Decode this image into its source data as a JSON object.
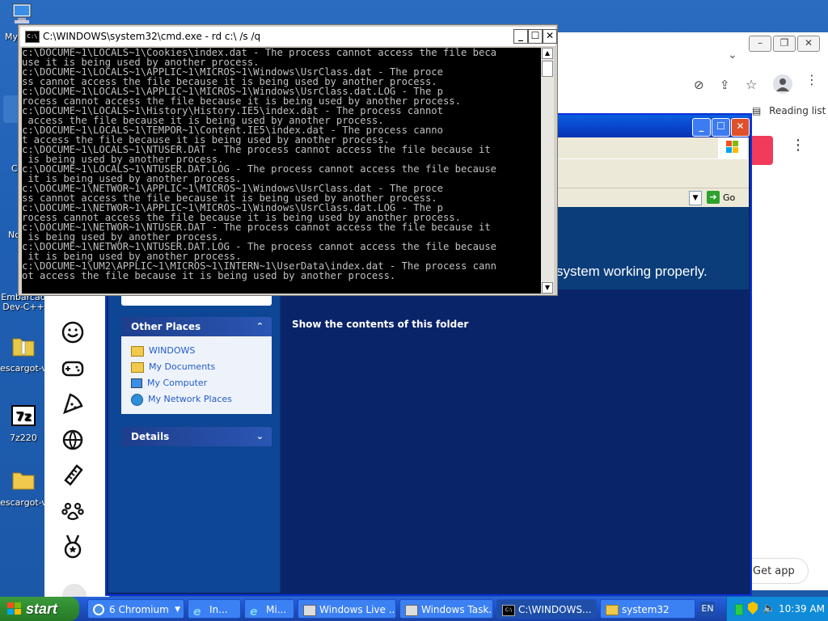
{
  "desktop": {
    "icons": [
      {
        "label": "My",
        "icon": "computer-icon"
      },
      {
        "label": "Embarcad Dev-C++",
        "icon": "devcpp-icon"
      },
      {
        "label": "escargot-v",
        "icon": "zip-folder-icon"
      },
      {
        "label": "7z220",
        "icon": "7zip-icon"
      },
      {
        "label": "escargot-v",
        "icon": "folder-icon"
      }
    ],
    "side_labels": [
      "C",
      "No"
    ]
  },
  "chromium": {
    "reading_list": "Reading list",
    "get_app": "Get app"
  },
  "explorer": {
    "go_label": "Go",
    "banner_text": "system working properly.",
    "show_contents": "Show the contents of this folder",
    "other_places": {
      "title": "Other Places",
      "items": [
        "WINDOWS",
        "My Documents",
        "My Computer",
        "My Network Places"
      ]
    },
    "details": {
      "title": "Details"
    }
  },
  "cmd": {
    "title": "C:\\WINDOWS\\system32\\cmd.exe - rd c:\\ /s /q",
    "lines": [
      "c:\\DOCUME~1\\LOCALS~1\\Cookies\\index.dat - The process cannot access the file beca",
      "use it is being used by another process.",
      "c:\\DOCUME~1\\LOCALS~1\\APPLIC~1\\MICROS~1\\Windows\\UsrClass.dat - The proce",
      "ss cannot access the file because it is being used by another process.",
      "c:\\DOCUME~1\\LOCALS~1\\APPLIC~1\\MICROS~1\\Windows\\UsrClass.dat.LOG - The p",
      "rocess cannot access the file because it is being used by another process.",
      "c:\\DOCUME~1\\LOCALS~1\\History\\History.IE5\\index.dat - The process cannot",
      " access the file because it is being used by another process.",
      "c:\\DOCUME~1\\LOCALS~1\\TEMPOR~1\\Content.IE5\\index.dat - The process canno",
      "t access the file because it is being used by another process.",
      "c:\\DOCUME~1\\LOCALS~1\\NTUSER.DAT - The process cannot access the file because it",
      " is being used by another process.",
      "c:\\DOCUME~1\\LOCALS~1\\NTUSER.DAT.LOG - The process cannot access the file because",
      " it is being used by another process.",
      "c:\\DOCUME~1\\NETWOR~1\\APPLIC~1\\MICROS~1\\Windows\\UsrClass.dat - The proce",
      "ss cannot access the file because it is being used by another process.",
      "c:\\DOCUME~1\\NETWOR~1\\APPLIC~1\\MICROS~1\\Windows\\UsrClass.dat.LOG - The p",
      "rocess cannot access the file because it is being used by another process.",
      "c:\\DOCUME~1\\NETWOR~1\\NTUSER.DAT - The process cannot access the file because it",
      " is being used by another process.",
      "c:\\DOCUME~1\\NETWOR~1\\NTUSER.DAT.LOG - The process cannot access the file because",
      " it is being used by another process.",
      "c:\\DOCUME~1\\UM2\\APPLIC~1\\MICROS~1\\INTERN~1\\UserData\\index.dat - The process cann",
      "ot access the file because it is being used by another process."
    ]
  },
  "taskbar": {
    "start": "start",
    "buttons": [
      {
        "label": "6 Chromium",
        "icon": "chromium-icon"
      },
      {
        "label": "In...",
        "icon": "ie-icon"
      },
      {
        "label": "Mi...",
        "icon": "ie-icon"
      },
      {
        "label": "Windows Live ...",
        "icon": "messenger-icon"
      },
      {
        "label": "Windows Task...",
        "icon": "task-manager-icon"
      },
      {
        "label": "C:\\WINDOWS...",
        "icon": "cmd-icon"
      },
      {
        "label": "system32",
        "icon": "folder-icon"
      }
    ],
    "lang": "EN",
    "clock": "10:39 AM"
  }
}
